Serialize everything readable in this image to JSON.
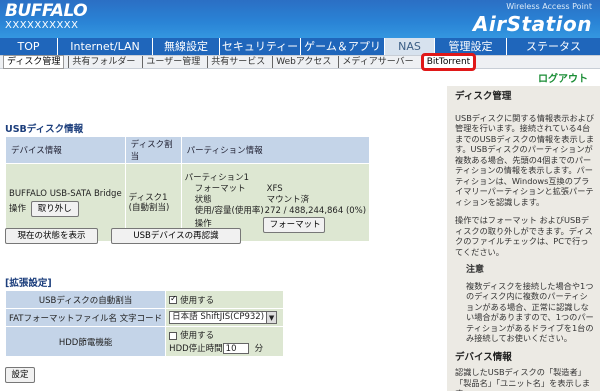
{
  "header": {
    "logo": "BUFFALO",
    "model": "XXXXXXXXXX",
    "product_sub": "Wireless Access Point",
    "product": "AirStation"
  },
  "nav": {
    "tabs": [
      "TOP",
      "Internet/LAN",
      "無線設定",
      "セキュリティー",
      "ゲーム＆アプリ",
      "NAS",
      "管理設定",
      "ステータス"
    ],
    "active": "NAS"
  },
  "subnav": {
    "items": [
      "ディスク管理",
      "共有フォルダー",
      "ユーザー管理",
      "共有サービス",
      "Webアクセス",
      "メディアサーバー",
      "BitTorrent"
    ],
    "active": "ディスク管理",
    "highlighted": "BitTorrent"
  },
  "logout": "ログアウト",
  "usb_section": {
    "title": "USBディスク情報",
    "headers": [
      "デバイス情報",
      "ディスク割当",
      "パーティション情報"
    ],
    "device_name": "BUFFALO USB-SATA Bridge",
    "operation_label": "操作",
    "remove_button": "取り外し",
    "disk_assign": "ディスク1\n(自動割当)",
    "partition": {
      "name": "パーティション1",
      "format_label": "フォーマット",
      "format_value": "XFS",
      "state_label": "状態",
      "state_value": "マウント済",
      "usage_label": "使用/容量(使用率)",
      "usage_value": "272 / 488,244,864 (0%)",
      "op_label": "操作",
      "format_button": "フォーマット"
    },
    "show_state_button": "現在の状態を表示",
    "rescan_button": "USBデバイスの再認識"
  },
  "ext_section": {
    "title": "[拡張設定]",
    "auto_assign_label": "USBディスクの自動割当",
    "auto_assign_value": "使用する",
    "fat_label": "FATフォーマットファイル名 文字コード",
    "fat_value": "日本語 ShiftJIS(CP932)",
    "hdd_label": "HDD節電機能",
    "hdd_use": "使用する",
    "hdd_stop_label": "HDD停止時間",
    "hdd_stop_value": "10",
    "hdd_stop_unit": "分",
    "save_button": "設定"
  },
  "side": {
    "title": "ディスク管理",
    "p1": "USBディスクに関する情報表示および管理を行います。接続されている4台までのUSBディスクの情報を表示します。USBディスクのパーティションが複数ある場合、先頭の4個までのパーティションの情報を表示します。パーティションは、Windows互換のプライマリーパーティションと拡張パーティションを認識します。",
    "p2": "操作ではフォーマット およびUSBディスクの取り外しができます。ディスクのファイルチェックは、PCで行ってください。",
    "note_title": "注意",
    "note": "複数ディスクを接続した場合や1つのディスク内に複数のパーティションがある場合、正常に認識しない場合がありますので、1つのパーティションがあるドライブを1台のみ接続してお使いください。",
    "dev_title": "デバイス情報",
    "dev_text": "認識したUSBディスクの「製造者」「製品名」「ユニット名」を表示します。"
  },
  "colors": {
    "header_blue": "#2a84d6",
    "nav_blue": "#1f66bb",
    "table_header": "#c4d4e8",
    "table_cell": "#dde7d2",
    "bittorrent_highlight": "#e01818",
    "logout_green": "#1a8d35"
  }
}
